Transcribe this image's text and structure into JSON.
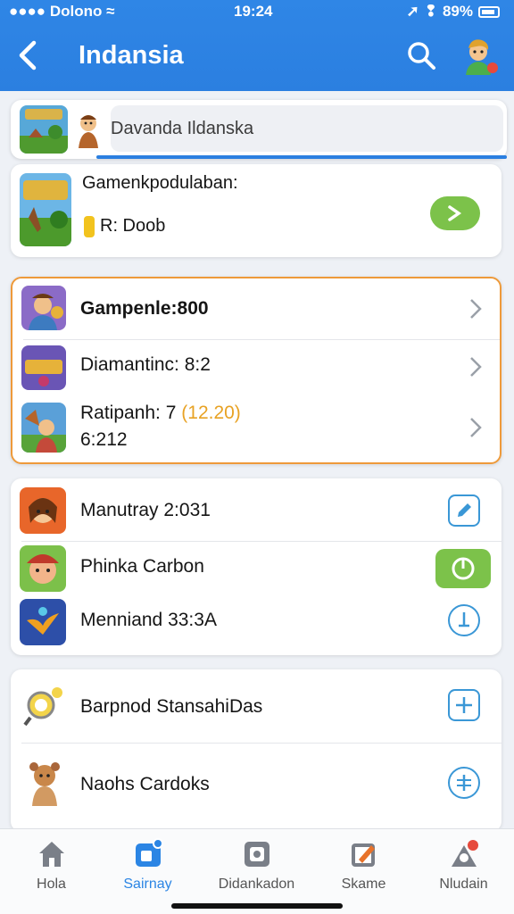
{
  "status": {
    "carrier": "Dolono",
    "time": "19:24",
    "battery": "89%"
  },
  "header": {
    "title": "Indansia"
  },
  "search": {
    "placeholder": "Davanda Ildanska"
  },
  "featured": {
    "title": "Gamenkpodulaban:",
    "subtitle": "R: Doob"
  },
  "highlight_list": [
    {
      "label": "Gampenle:800",
      "sub": "",
      "badge": ""
    },
    {
      "label": "Diamantinc: 8:2",
      "sub": "",
      "badge": ""
    },
    {
      "label": "Ratipanh: 7",
      "badge": "(12.20)",
      "sub": "6:212"
    }
  ],
  "list2": [
    {
      "label": "Manutray 2:031"
    },
    {
      "label": "Phinka Carbon"
    },
    {
      "label": "Menniand 33:3A"
    }
  ],
  "list3": [
    {
      "label": "Barpnod StansahiDas"
    },
    {
      "label": "Naohs Cardoks"
    }
  ],
  "nav": [
    {
      "label": "Hola"
    },
    {
      "label": "Sairnay"
    },
    {
      "label": "Didankadon"
    },
    {
      "label": "Skame"
    },
    {
      "label": "Nludain"
    }
  ],
  "colors": {
    "accent": "#2b7fe0",
    "highlight_border": "#ee9a3a",
    "green": "#7cc24a",
    "badge_orange": "#e8a224"
  }
}
